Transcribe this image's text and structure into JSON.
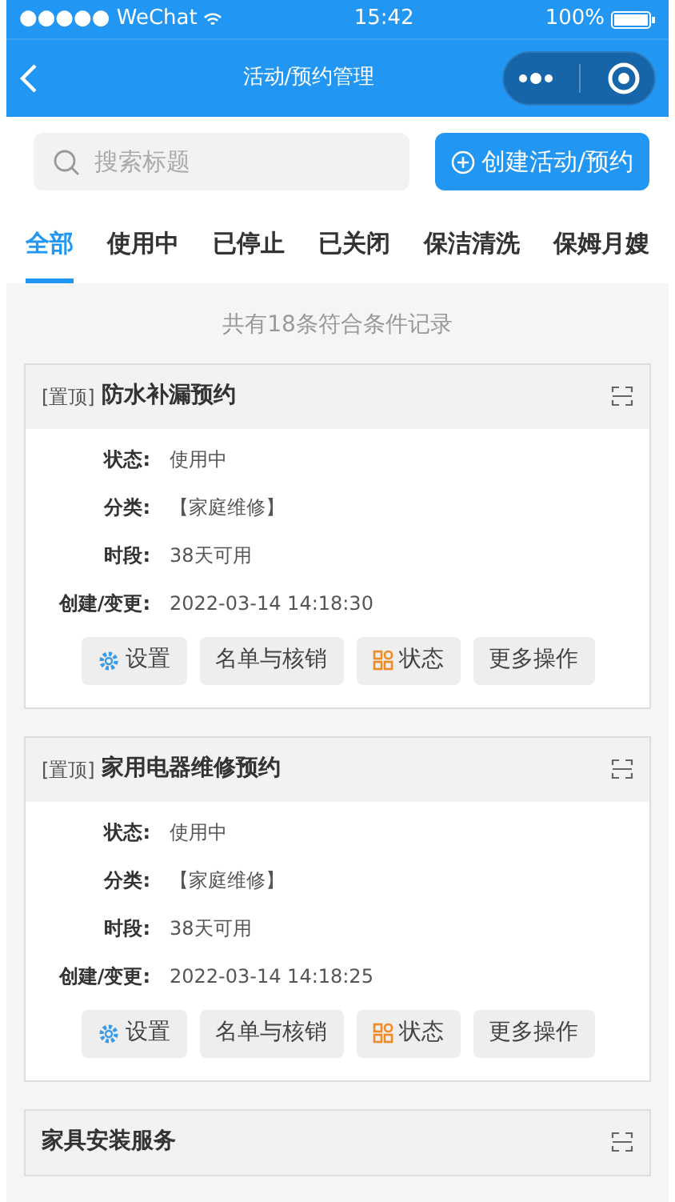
{
  "status_bar": {
    "carrier": "●●●●● WeChat",
    "time": "15:42",
    "battery": "100%"
  },
  "nav": {
    "title": "活动/预约管理"
  },
  "search": {
    "placeholder": "搜索标题"
  },
  "create_button": "创建活动/预约",
  "tabs": [
    {
      "label": "全部",
      "selected": true
    },
    {
      "label": "使用中",
      "selected": false
    },
    {
      "label": "已停止",
      "selected": false
    },
    {
      "label": "已关闭",
      "selected": false
    },
    {
      "label": "保洁清洗",
      "selected": false
    },
    {
      "label": "保姆月嫂",
      "selected": false
    }
  ],
  "summary": "共有18条符合条件记录",
  "cards": [
    {
      "pin_tag": "[置顶]",
      "title": "防水补漏预约",
      "fields": [
        {
          "label": "状态:",
          "value": "使用中"
        },
        {
          "label": "分类:",
          "value": "【家庭维修】"
        },
        {
          "label": "时段:",
          "value": "38天可用"
        },
        {
          "label": "创建/变更:",
          "value": "2022-03-14 14:18:30"
        }
      ],
      "actions": [
        {
          "label": "设置",
          "kind": "settings"
        },
        {
          "label": "名单与核销",
          "kind": "plain"
        },
        {
          "label": "状态",
          "kind": "status"
        },
        {
          "label": "更多操作",
          "kind": "plain"
        }
      ]
    },
    {
      "pin_tag": "[置顶]",
      "title": "家用电器维修预约",
      "fields": [
        {
          "label": "状态:",
          "value": "使用中"
        },
        {
          "label": "分类:",
          "value": "【家庭维修】"
        },
        {
          "label": "时段:",
          "value": "38天可用"
        },
        {
          "label": "创建/变更:",
          "value": "2022-03-14 14:18:25"
        }
      ],
      "actions": [
        {
          "label": "设置",
          "kind": "settings"
        },
        {
          "label": "名单与核销",
          "kind": "plain"
        },
        {
          "label": "状态",
          "kind": "status"
        },
        {
          "label": "更多操作",
          "kind": "plain"
        }
      ]
    },
    {
      "title": "家具安装服务"
    }
  ]
}
